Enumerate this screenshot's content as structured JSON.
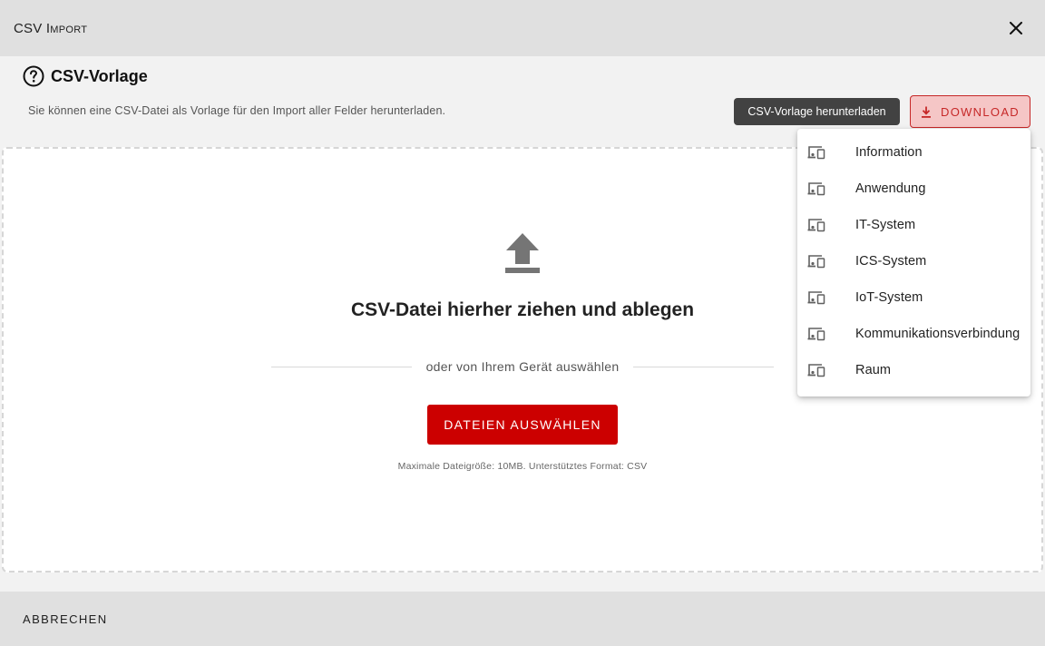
{
  "dialog": {
    "title_first": "CSV",
    "title_rest": "Import",
    "close_icon": "close-icon"
  },
  "template": {
    "heading": "CSV-Vorlage",
    "hint": "Sie können eine CSV-Datei als Vorlage für den Import aller Felder herunterladen.",
    "tooltip": "CSV-Vorlage herunterladen",
    "download_label": "DOWNLOAD",
    "download_icon": "download-icon",
    "help_icon": "help-circle-icon"
  },
  "menu": {
    "items": [
      {
        "label": "Information",
        "icon": "devices-icon"
      },
      {
        "label": "Anwendung",
        "icon": "devices-icon"
      },
      {
        "label": "IT-System",
        "icon": "devices-icon"
      },
      {
        "label": "ICS-System",
        "icon": "devices-icon"
      },
      {
        "label": "IoT-System",
        "icon": "devices-icon"
      },
      {
        "label": "Kommunikationsverbindung",
        "icon": "devices-icon"
      },
      {
        "label": "Raum",
        "icon": "devices-icon"
      }
    ]
  },
  "dropzone": {
    "title": "CSV-Datei hierher ziehen und ablegen",
    "or_text": "oder von Ihrem Gerät auswählen",
    "select_button": "DATEIEN AUSWÄHLEN",
    "limit_note": "Maximale Dateigröße: 10MB. Unterstütztes Format: CSV",
    "upload_icon": "upload-icon"
  },
  "footer": {
    "cancel_label": "ABBRECHEN"
  },
  "colors": {
    "accent": "#cc0000",
    "accent_light": "#f5c6c6",
    "header_bg": "#e0e0e0",
    "tooltip_bg": "#424242"
  }
}
